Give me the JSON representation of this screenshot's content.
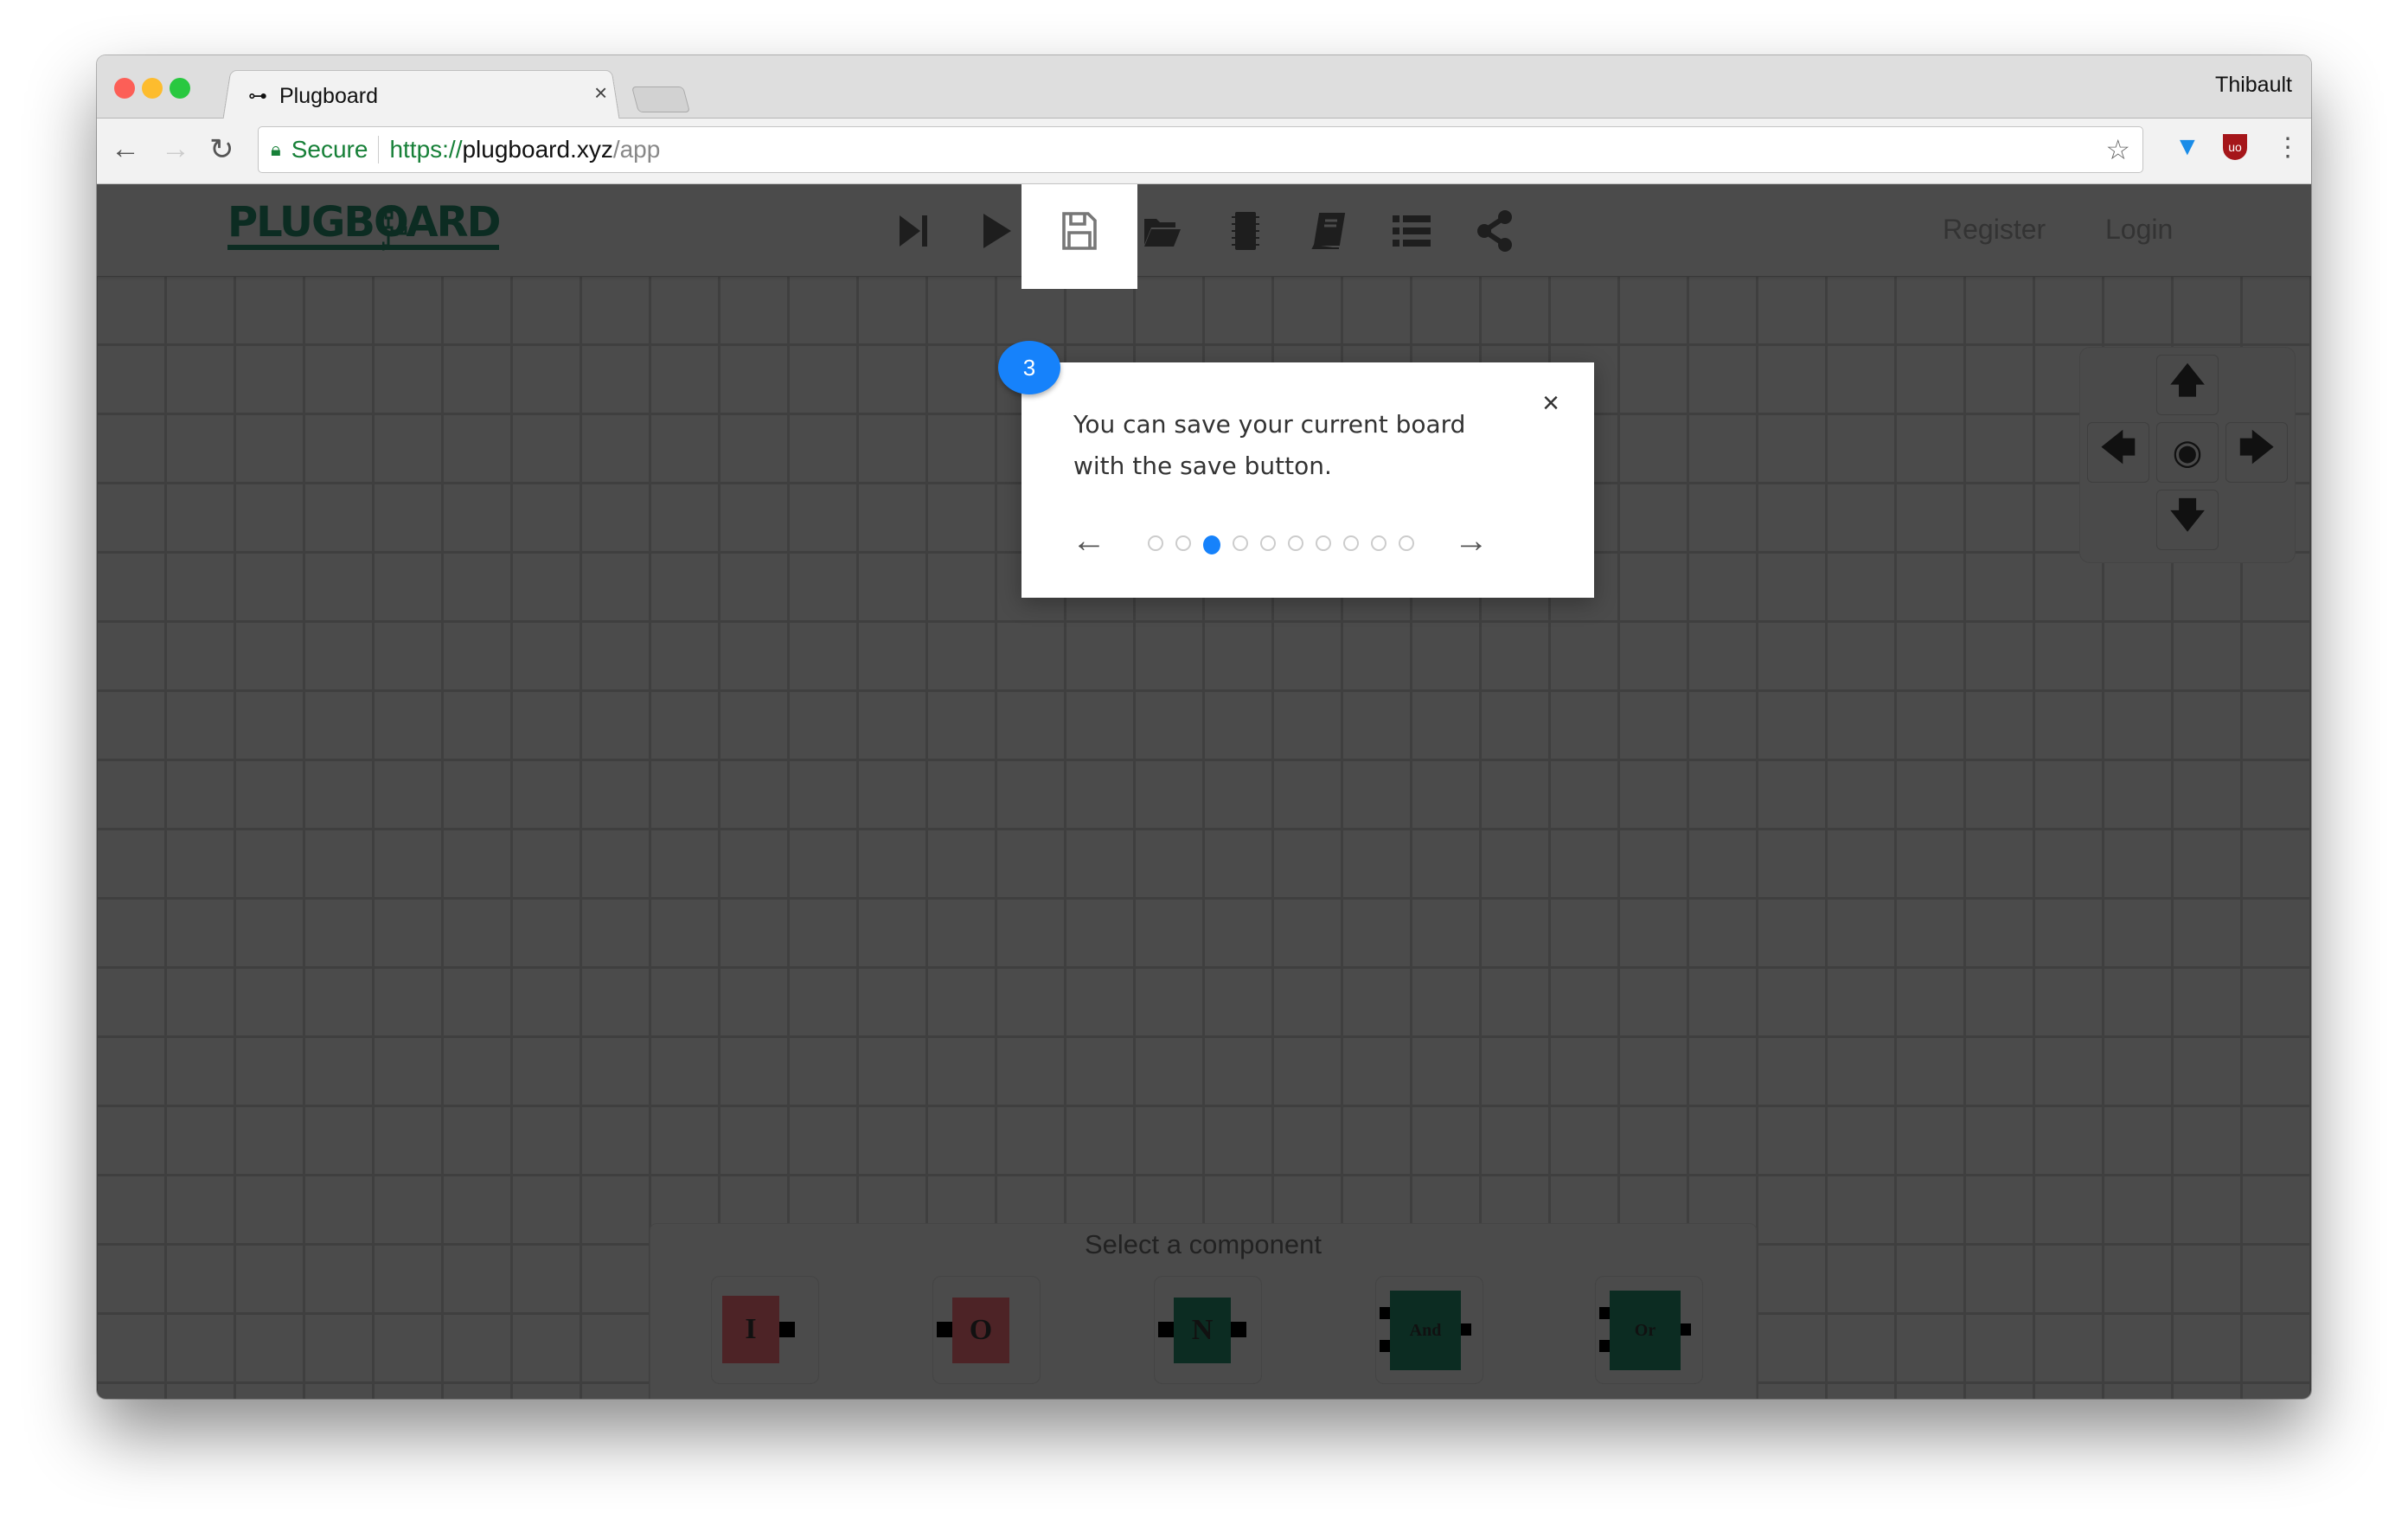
{
  "browser": {
    "tab_title": "Plugboard",
    "user_name": "Thibault",
    "secure_label": "Secure",
    "url_scheme": "https://",
    "url_host": "plugboard.xyz",
    "url_path": "/app"
  },
  "app": {
    "logo_text": "PLUGBOARD",
    "toolbar": [
      "step-forward",
      "play",
      "save",
      "open-folder",
      "chip",
      "book",
      "list",
      "share"
    ],
    "register_label": "Register",
    "login_label": "Login"
  },
  "tour": {
    "step_number": "3",
    "text": "You can save your current board with the save button.",
    "total_steps": 10,
    "current_step": 3,
    "close_label": "×"
  },
  "component_panel": {
    "title": "Select a component",
    "components": [
      {
        "label": "I",
        "color": "#4d2326"
      },
      {
        "label": "O",
        "color": "#4d2326"
      },
      {
        "label": "N",
        "color": "#0c2c22"
      },
      {
        "label": "And",
        "color": "#0c2c22"
      },
      {
        "label": "Or",
        "color": "#0c2c22"
      }
    ]
  },
  "colors": {
    "accent": "#1682fb",
    "logo": "#0c2c22"
  }
}
